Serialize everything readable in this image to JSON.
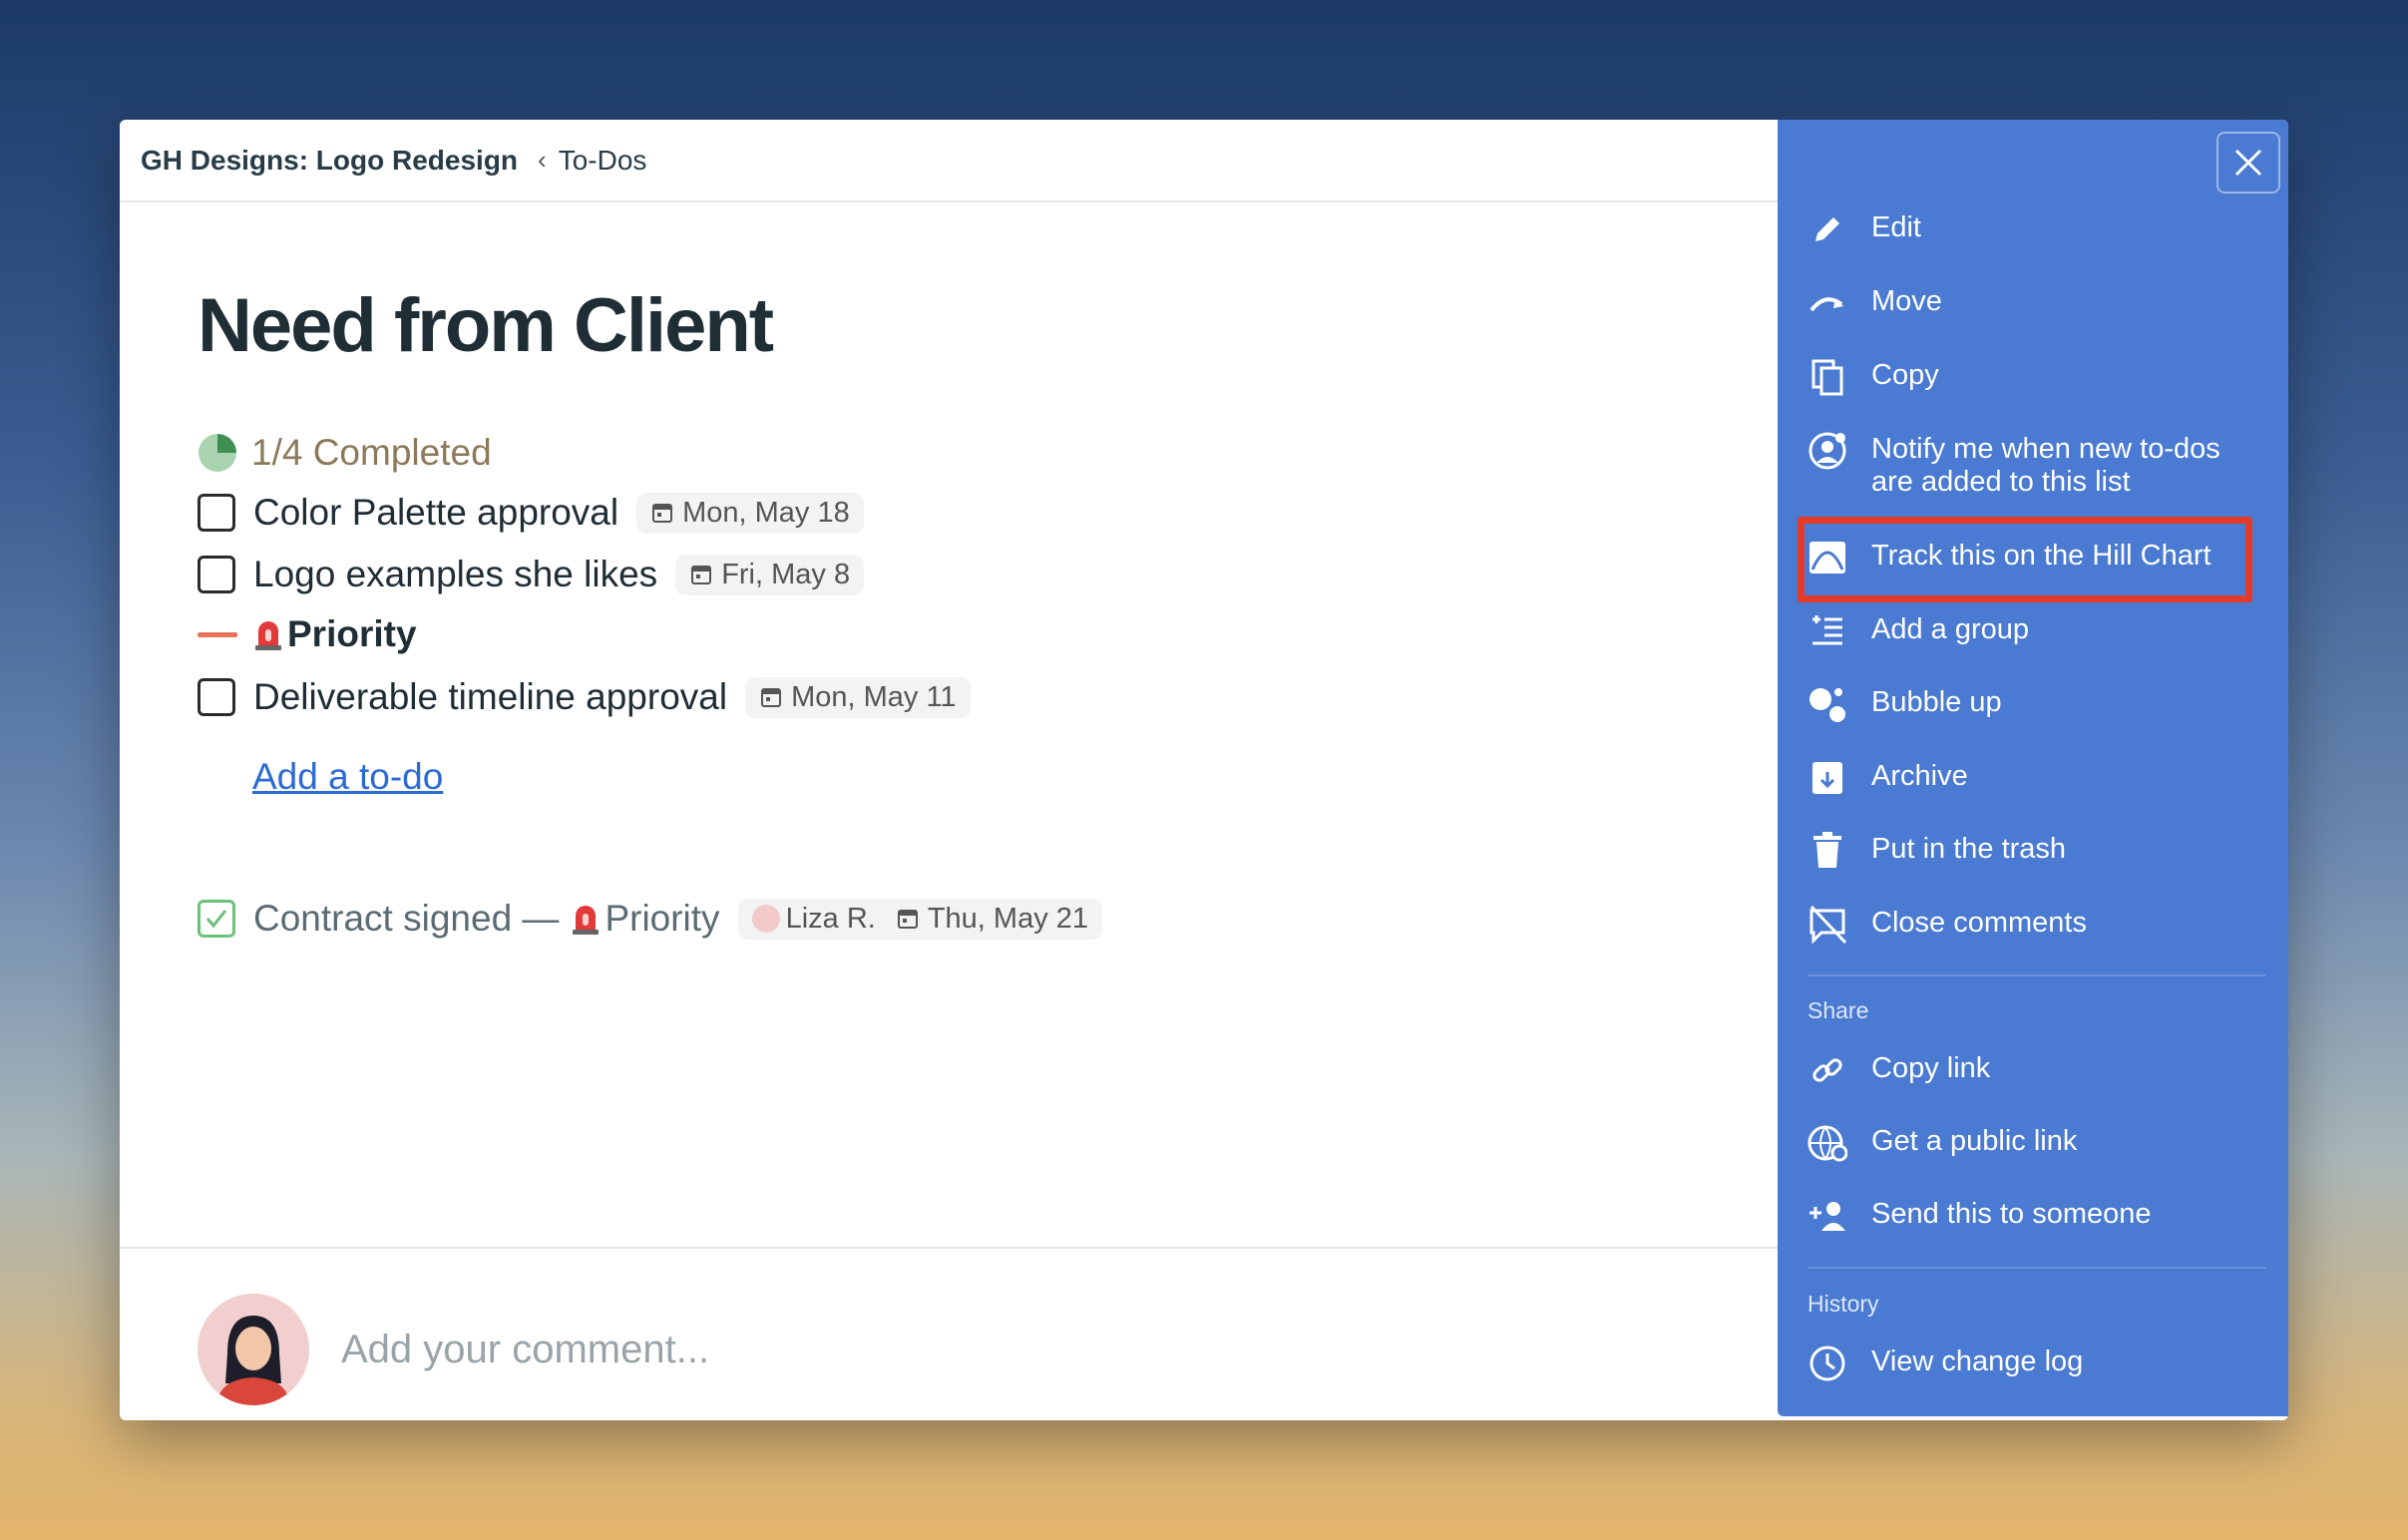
{
  "breadcrumb": {
    "project": "GH Designs: Logo Redesign",
    "separator": "‹",
    "section": "To-Dos"
  },
  "list": {
    "title": "Need from Client",
    "progress": "1/4 Completed",
    "progress_fraction": 0.25,
    "todos": [
      {
        "label": "Color Palette approval",
        "date": "Mon, May 18"
      },
      {
        "label": "Logo examples she likes",
        "date": "Fri, May 8"
      }
    ],
    "group": {
      "label": "Priority"
    },
    "group_todos": [
      {
        "label": "Deliverable timeline approval",
        "date": "Mon, May 11"
      }
    ],
    "add_todo": "Add a to-do",
    "completed": {
      "label": "Contract signed —",
      "tag": "Priority",
      "assignee": "Liza R.",
      "date": "Thu, May 21"
    }
  },
  "comment": {
    "placeholder": "Add your comment..."
  },
  "menu": {
    "items": [
      {
        "label": "Edit",
        "icon": "pencil-icon"
      },
      {
        "label": "Move",
        "icon": "move-arrow-icon"
      },
      {
        "label": "Copy",
        "icon": "copy-icon"
      },
      {
        "label": "Notify me when new to-dos are added to this list",
        "icon": "notify-person-icon"
      },
      {
        "label": "Track this on the Hill Chart",
        "icon": "hill-chart-icon"
      },
      {
        "label": "Add a group",
        "icon": "add-group-icon"
      },
      {
        "label": "Bubble up",
        "icon": "bubble-icon"
      },
      {
        "label": "Archive",
        "icon": "archive-icon"
      },
      {
        "label": "Put in the trash",
        "icon": "trash-icon"
      },
      {
        "label": "Close comments",
        "icon": "close-comments-icon"
      }
    ],
    "share_label": "Share",
    "share_items": [
      {
        "label": "Copy link",
        "icon": "link-icon"
      },
      {
        "label": "Get a public link",
        "icon": "globe-link-icon"
      },
      {
        "label": "Send this to someone",
        "icon": "add-person-icon"
      }
    ],
    "history_label": "History",
    "history_items": [
      {
        "label": "View change log",
        "icon": "clock-icon"
      }
    ]
  },
  "colors": {
    "menu_bg": "#4a7ad1",
    "highlight": "#e43b2b",
    "link": "#2c6ad4",
    "priority_dash": "#e8735a"
  }
}
